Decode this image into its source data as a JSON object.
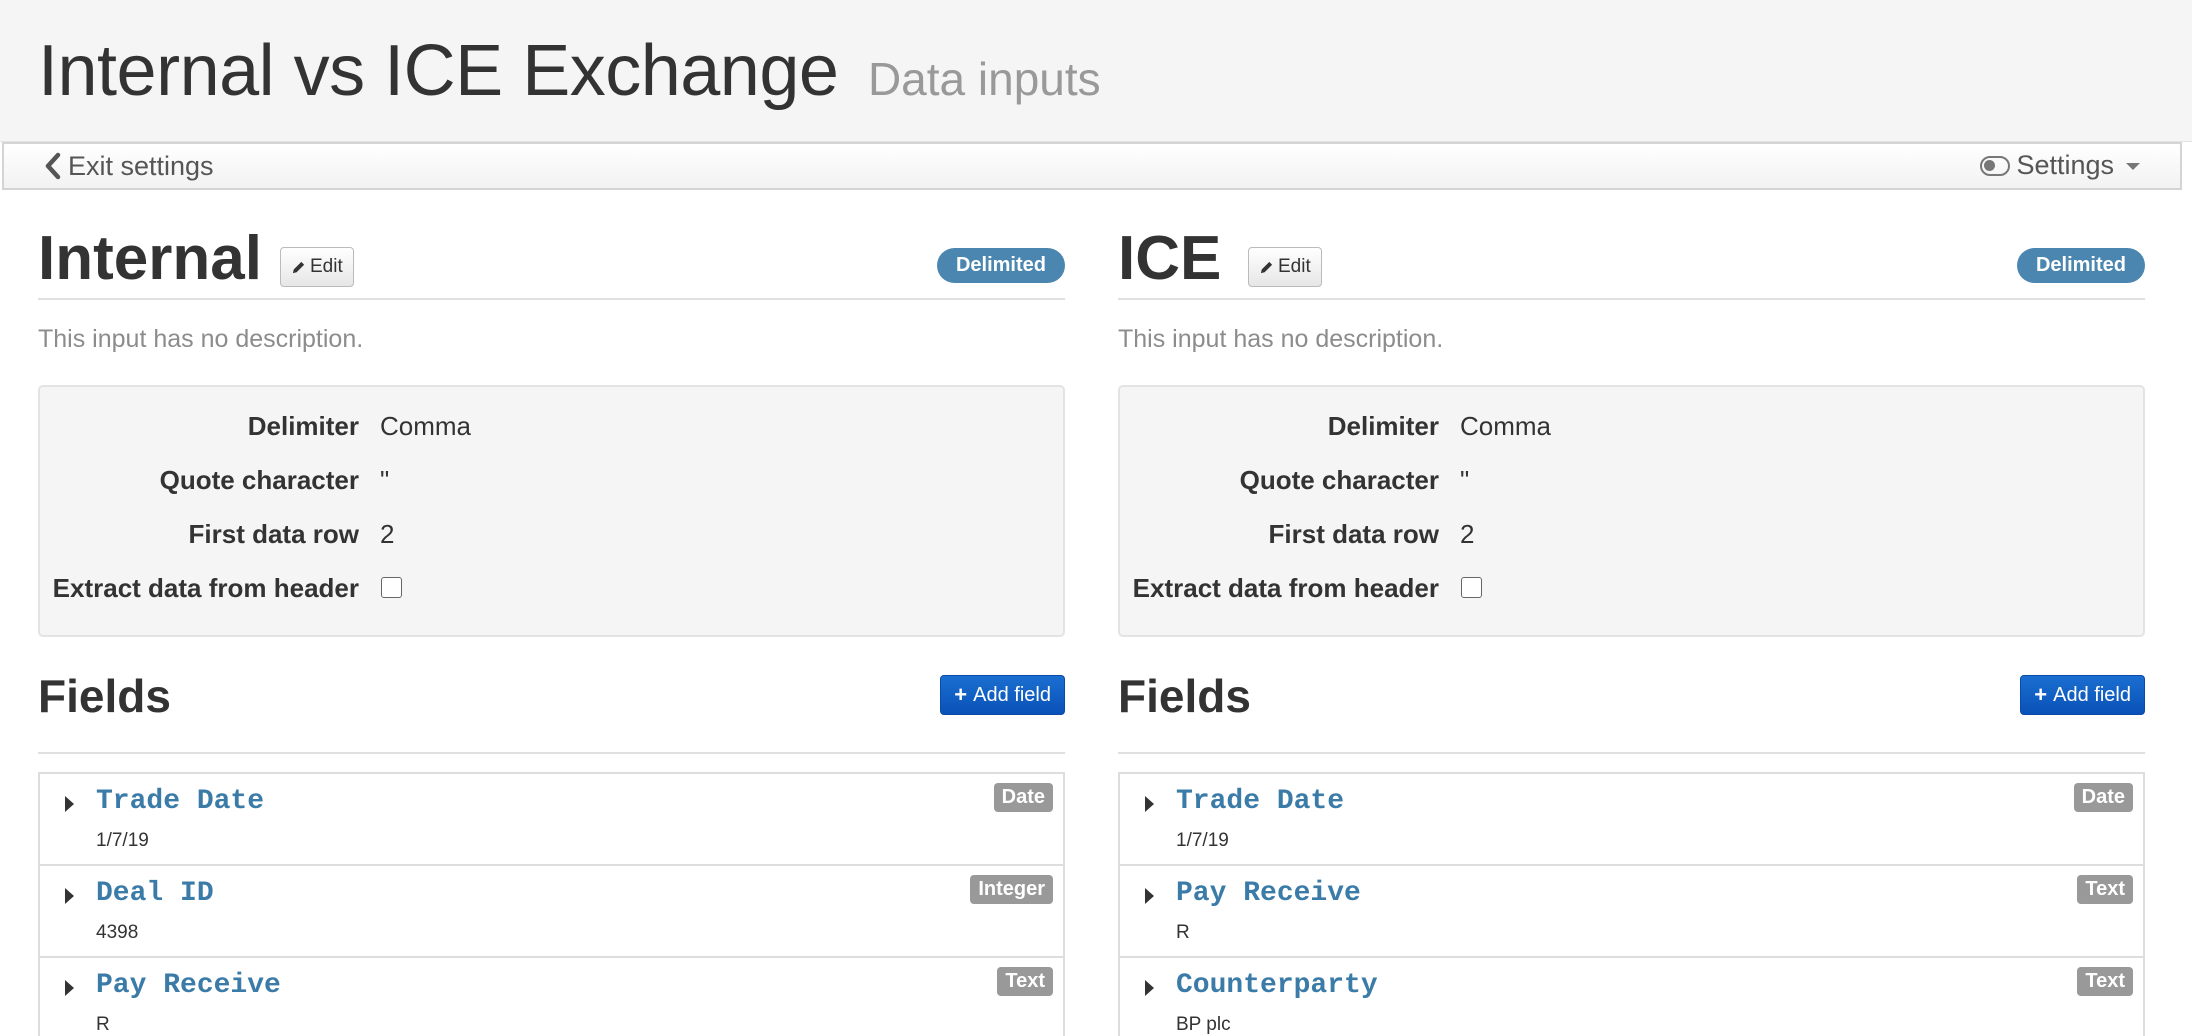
{
  "header": {
    "title": "Internal vs ICE Exchange",
    "subtitle": "Data inputs"
  },
  "toolbar": {
    "exit_label": "Exit settings",
    "settings_label": "Settings"
  },
  "inputs": [
    {
      "title": "Internal",
      "edit_label": "Edit",
      "badge": "Delimited",
      "description": "This input has no description.",
      "settings": {
        "delimiter_label": "Delimiter",
        "delimiter_value": "Comma",
        "quote_label": "Quote character",
        "quote_value": "\"",
        "first_row_label": "First data row",
        "first_row_value": "2",
        "extract_header_label": "Extract data from header",
        "extract_header_checked": false
      },
      "fields_title": "Fields",
      "add_field_label": "Add field",
      "fields": [
        {
          "name": "Trade Date",
          "type": "Date",
          "sample": "1/7/19"
        },
        {
          "name": "Deal ID",
          "type": "Integer",
          "sample": "4398"
        },
        {
          "name": "Pay Receive",
          "type": "Text",
          "sample": "R"
        }
      ]
    },
    {
      "title": "ICE",
      "edit_label": "Edit",
      "badge": "Delimited",
      "description": "This input has no description.",
      "settings": {
        "delimiter_label": "Delimiter",
        "delimiter_value": "Comma",
        "quote_label": "Quote character",
        "quote_value": "\"",
        "first_row_label": "First data row",
        "first_row_value": "2",
        "extract_header_label": "Extract data from header",
        "extract_header_checked": false
      },
      "fields_title": "Fields",
      "add_field_label": "Add field",
      "fields": [
        {
          "name": "Trade Date",
          "type": "Date",
          "sample": "1/7/19"
        },
        {
          "name": "Pay Receive",
          "type": "Text",
          "sample": "R"
        },
        {
          "name": "Counterparty",
          "type": "Text",
          "sample": "BP plc"
        }
      ]
    }
  ],
  "colors": {
    "badge_blue": "#4a86b0",
    "primary_button": "#0a51b7",
    "field_name": "#3b7ba8",
    "type_label": "#999999"
  },
  "icons": {
    "exit": "chevron-left-icon",
    "settings": "toggle-icon",
    "edit": "pencil-icon",
    "add": "plus-icon",
    "field_expand": "caret-right-icon"
  }
}
